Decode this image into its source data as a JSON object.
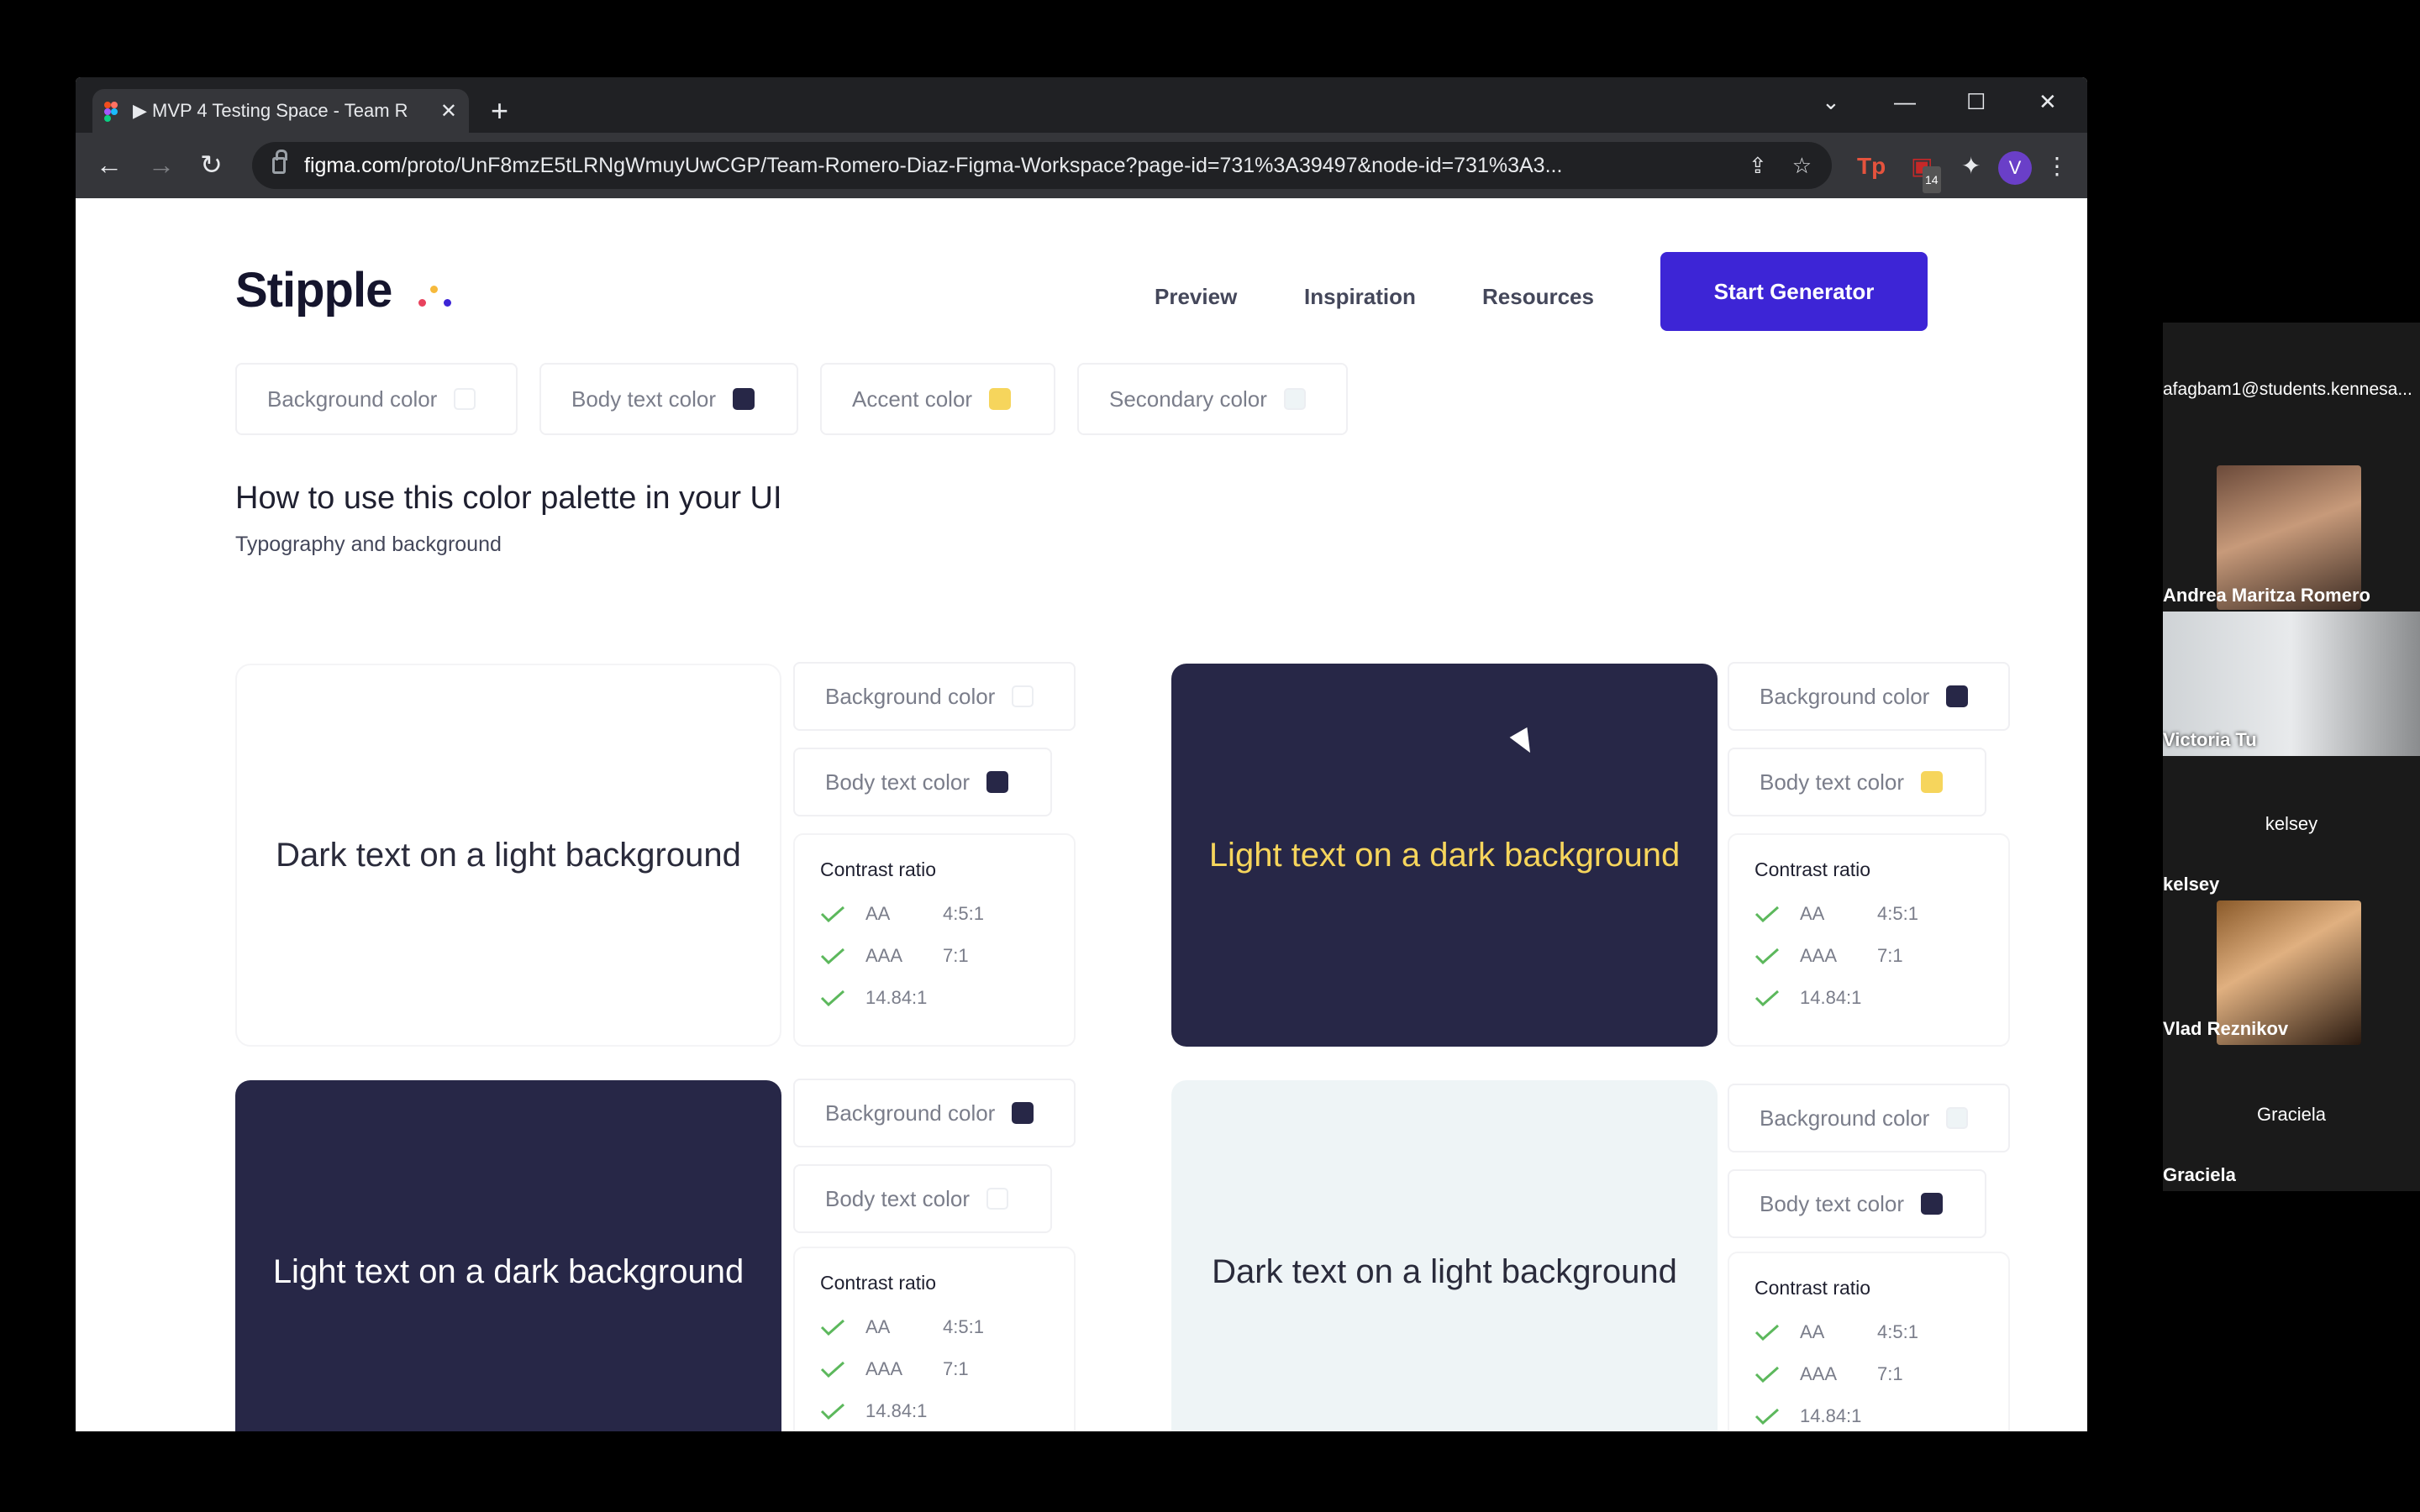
{
  "browser": {
    "tab_title": "▶ MVP 4 Testing Space - Team R",
    "url_domain": "figma.com",
    "url_path": "/proto/UnF8mzE5tLRNgWmuyUwCGP/Team-Romero-Diaz-Figma-Workspace?page-id=731%3A39497&node-id=731%3A3...",
    "extension_badge": "14",
    "profile_initial": "V"
  },
  "site": {
    "logo": "Stipple",
    "nav": [
      "Preview",
      "Inspiration",
      "Resources"
    ],
    "cta": "Start Generator",
    "chips": [
      {
        "label": "Background color",
        "color": "#ffffff"
      },
      {
        "label": "Body text color",
        "color": "#272747"
      },
      {
        "label": "Accent color",
        "color": "#f6d55c"
      },
      {
        "label": "Secondary color",
        "color": "#eef4f6"
      }
    ],
    "heading": "How to use this color palette in your UI",
    "subheading": "Typography and background",
    "examples": [
      {
        "preview_text": "Dark text on a light background",
        "bg_label": "Background color",
        "bg_color": "#ffffff",
        "text_label": "Body text color",
        "text_color": "#272747"
      },
      {
        "preview_text": "Light text on a dark background",
        "bg_label": "Background color",
        "bg_color": "#272747",
        "text_label": "Body text color",
        "text_color": "#f6d55c"
      },
      {
        "preview_text": "Light text on a dark background",
        "bg_label": "Background color",
        "bg_color": "#272747",
        "text_label": "Body text color",
        "text_color": "#ffffff"
      },
      {
        "preview_text": "Dark text on a light background",
        "bg_label": "Background color",
        "bg_color": "#eef4f6",
        "text_label": "Body text color",
        "text_color": "#272747"
      }
    ],
    "contrast": {
      "title": "Contrast ratio",
      "rows": [
        {
          "level": "AA",
          "ratio": "4:5:1"
        },
        {
          "level": "AAA",
          "ratio": "7:1"
        },
        {
          "level": "14.84:1",
          "ratio": ""
        }
      ]
    }
  },
  "participants": [
    {
      "name": "afagbam1@students.kennesa..."
    },
    {
      "name": "Andrea Maritza Romero"
    },
    {
      "name": "Victoria Tu"
    },
    {
      "name": "kelsey",
      "center": "kelsey"
    },
    {
      "name": "Vlad Reznikov"
    },
    {
      "name": "Graciela",
      "center": "Graciela"
    }
  ],
  "colors": {
    "accent": "#3d25d6",
    "dark": "#272747",
    "yellow": "#f6d55c",
    "check": "#5cb85c"
  }
}
